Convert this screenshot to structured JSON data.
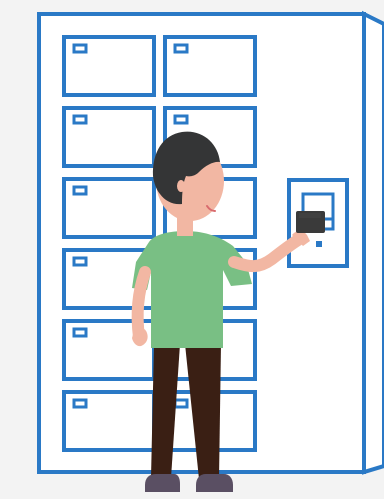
{
  "scene": {
    "description_items": [],
    "locker": {
      "compartment_rows": 6,
      "compartment_columns": 2,
      "terminal_present": true
    },
    "colors": {
      "background": "#f3f3f3",
      "locker_outline": "#2a79c6",
      "locker_fill": "#ffffff",
      "shirt": "#79bf84",
      "hair": "#343536",
      "skin": "#f2b7a3",
      "pants": "#3a1f14",
      "shoes": "#5a4f63",
      "card": "#3a3a3a"
    }
  }
}
